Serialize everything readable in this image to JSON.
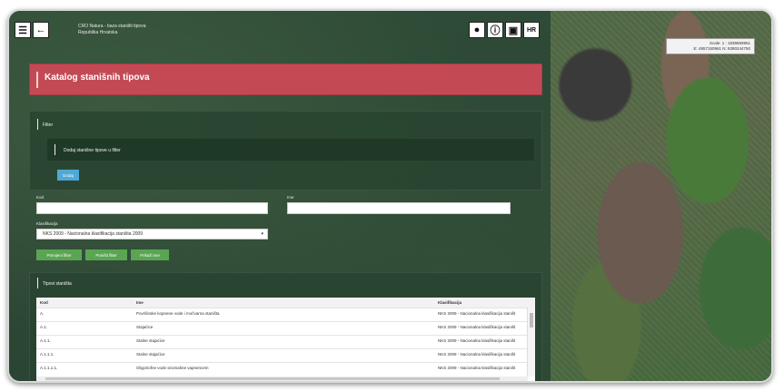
{
  "topbar": {
    "brand_line1": "CRO Natura - baza staništi tipova",
    "brand_line2": "Republika Hrvatska",
    "lang_label": "HR"
  },
  "page": {
    "title": "Katalog stanišnih tipova"
  },
  "filter": {
    "section_label": "Filter",
    "add_prompt": "Dodaj stanišne tipove u filter",
    "add_button": "Dodaj",
    "kod_label": "Kod",
    "ime_label": "Ime",
    "kod_value": "",
    "ime_value": "",
    "klasifikacija_label": "Klasifikacija",
    "klasifikacija_value": "NKS 2009 - Nacionalna klasifikacija staništa 2009",
    "buttons": {
      "primijeni": "Primijeni filter",
      "ponisti": "Poništi filter",
      "prikazi": "Prikaži sve"
    }
  },
  "types": {
    "section_label": "Tipovi staništa",
    "columns": [
      "Kod",
      "Ime",
      "Klasifikacija"
    ],
    "rows": [
      {
        "kod": "A.",
        "ime": "Površinske kopnene vode i močvarna staništa",
        "klas": "NKS 2009 - Nacionalna klasifikacija staništ"
      },
      {
        "kod": "A.1.",
        "ime": "Stajaćice",
        "klas": "NKS 2009 - Nacionalna klasifikacija staništ"
      },
      {
        "kod": "A.1.1.",
        "ime": "Stalne stajaćice",
        "klas": "NKS 2009 - Nacionalna klasifikacija staništ"
      },
      {
        "kod": "A.1.1.1.",
        "ime": "Stalne stajaćice",
        "klas": "NKS 2009 - Nacionalna klasifikacija staništ"
      },
      {
        "kod": "A.1.1.1.1.",
        "ime": "Oligotrofne vode siromašne vapnencem",
        "klas": "NKS 2009 - Nacionalna klasifikacija staništ"
      }
    ]
  },
  "map": {
    "scale_text": "Scale: 1 : 1838659951",
    "coords_text": "E: 4957150961 N: 8390244750"
  },
  "icons": {
    "menu": "menu-icon",
    "back": "back-arrow-icon",
    "user": "user-icon",
    "info": "info-icon",
    "book": "book-icon"
  }
}
